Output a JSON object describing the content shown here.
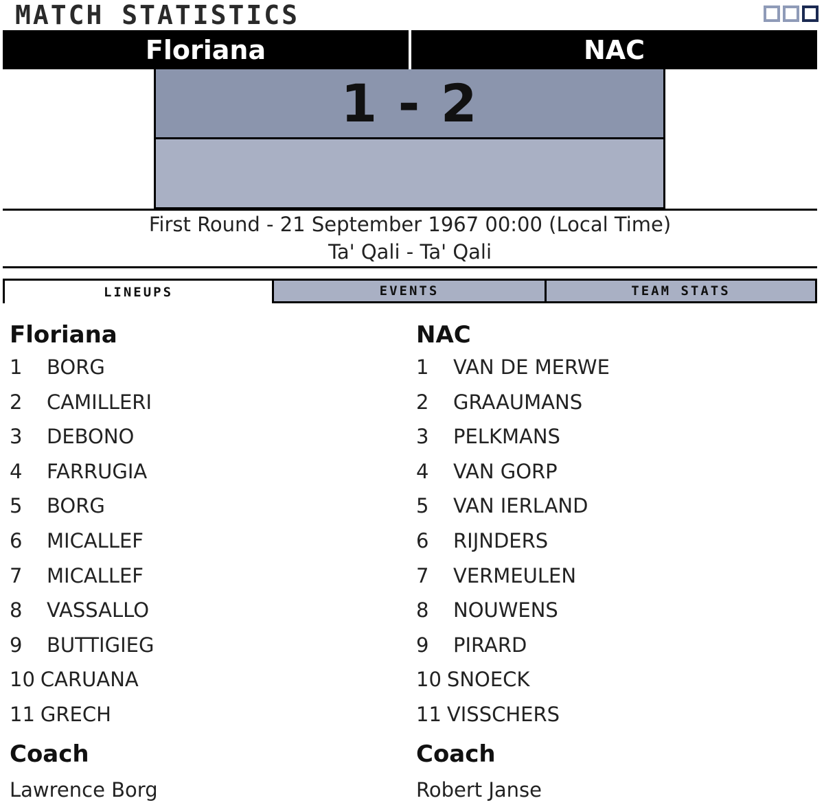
{
  "header": {
    "title": "MATCH STATISTICS"
  },
  "match": {
    "home_team": "Floriana",
    "away_team": "NAC",
    "score": "1 - 2",
    "round_date": "First Round - 21 September 1967 00:00 (Local Time)",
    "venue": "Ta' Qali - Ta' Qali"
  },
  "tabs": [
    {
      "label": "LINEUPS",
      "active": true
    },
    {
      "label": "EVENTS",
      "active": false
    },
    {
      "label": "TEAM STATS",
      "active": false
    }
  ],
  "lineups": {
    "home": {
      "team": "Floriana",
      "players": [
        {
          "num": "1",
          "name": "BORG"
        },
        {
          "num": "2",
          "name": "CAMILLERI"
        },
        {
          "num": "3",
          "name": "DEBONO"
        },
        {
          "num": "4",
          "name": "FARRUGIA"
        },
        {
          "num": "5",
          "name": "BORG"
        },
        {
          "num": "6",
          "name": "MICALLEF"
        },
        {
          "num": "7",
          "name": "MICALLEF"
        },
        {
          "num": "8",
          "name": "VASSALLO"
        },
        {
          "num": "9",
          "name": "BUTTIGIEG"
        },
        {
          "num": "10",
          "name": "CARUANA"
        },
        {
          "num": "11",
          "name": "GRECH"
        }
      ],
      "coach_title": "Coach",
      "coach": "Lawrence Borg"
    },
    "away": {
      "team": "NAC",
      "players": [
        {
          "num": "1",
          "name": "VAN DE MERWE"
        },
        {
          "num": "2",
          "name": "GRAAUMANS"
        },
        {
          "num": "3",
          "name": "PELKMANS"
        },
        {
          "num": "4",
          "name": "VAN GORP"
        },
        {
          "num": "5",
          "name": "VAN IERLAND"
        },
        {
          "num": "6",
          "name": "RIJNDERS"
        },
        {
          "num": "7",
          "name": "VERMEULEN"
        },
        {
          "num": "8",
          "name": "NOUWENS"
        },
        {
          "num": "9",
          "name": "PIRARD"
        },
        {
          "num": "10",
          "name": "SNOECK"
        },
        {
          "num": "11",
          "name": "VISSCHERS"
        }
      ],
      "coach_title": "Coach",
      "coach": "Robert Janse"
    }
  },
  "colors": {
    "header_bar": "#000000",
    "score_top": "#8b95ad",
    "score_bottom": "#a9b0c4",
    "tab_inactive": "#a9b0c4",
    "window_control": "#8f9bb8",
    "window_control_active": "#1b2a52"
  }
}
